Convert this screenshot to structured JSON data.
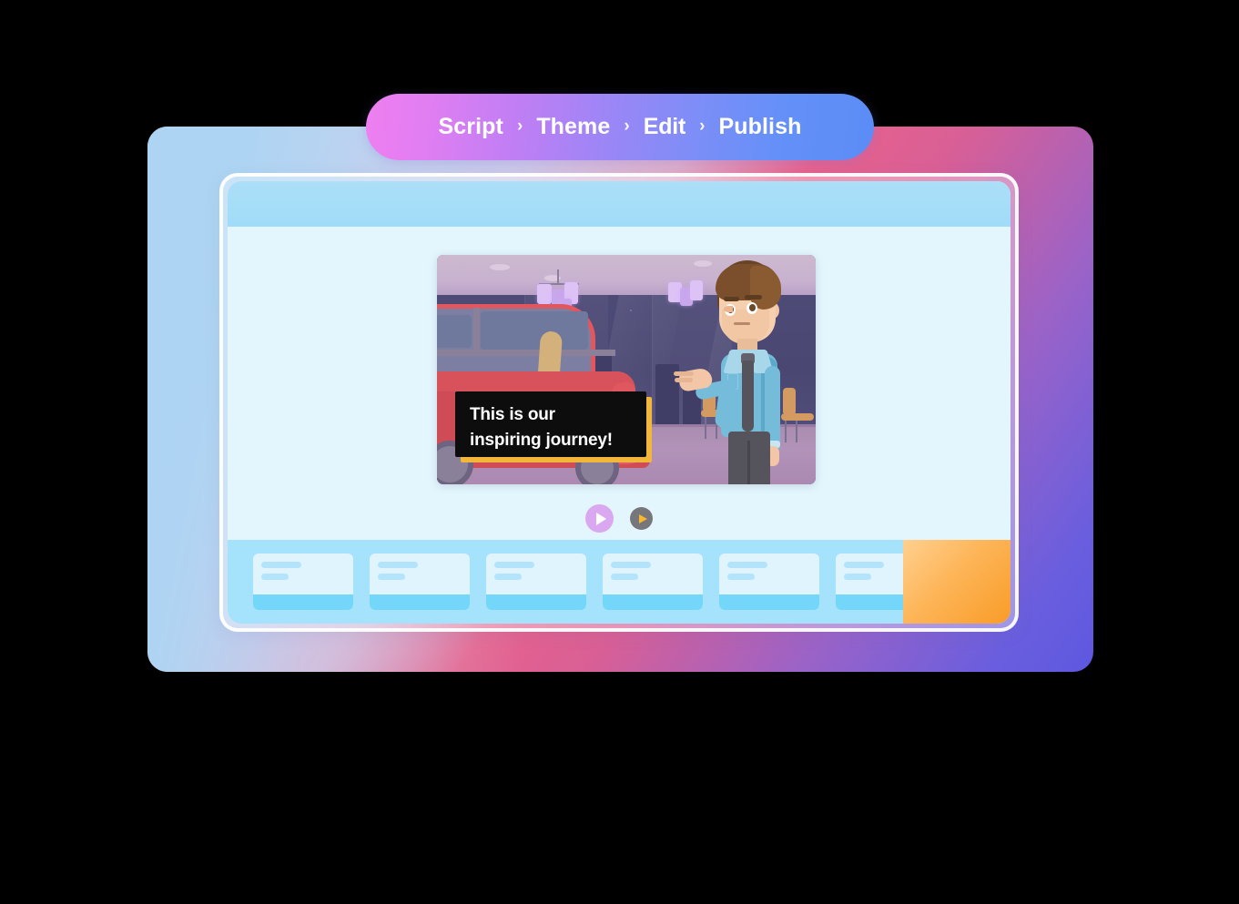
{
  "breadcrumb": {
    "separator": "›",
    "steps": [
      {
        "label": "Script",
        "active": false
      },
      {
        "label": "Theme",
        "active": false
      },
      {
        "label": "Edit",
        "active": true
      },
      {
        "label": "Publish",
        "active": false
      }
    ]
  },
  "editor": {
    "topbar_label": "",
    "video": {
      "caption_line_1": "This is our",
      "caption_line_2": "inspiring journey!",
      "scene_description": "Car showroom with presenter"
    },
    "controls": {
      "play_primary": "play-icon",
      "play_secondary": "play-icon"
    },
    "timeline": {
      "scenes": [
        {
          "id": "scene-1"
        },
        {
          "id": "scene-2"
        },
        {
          "id": "scene-3"
        },
        {
          "id": "scene-4"
        },
        {
          "id": "scene-5"
        },
        {
          "id": "scene-6"
        }
      ],
      "add_panel_label": ""
    }
  },
  "colors": {
    "accent_pink": "#ef7ff0",
    "accent_blue": "#5b8cf5",
    "caption_bg": "#0d0d0d",
    "caption_shadow": "#f2b63a",
    "timeline_bg": "#a5e2fb",
    "timeline_card": "#dff4fd",
    "timeline_card_foot": "#74d6f9",
    "orange_panel": "#f99c28",
    "play_primary": "#d9a8f0",
    "play_secondary": "#77767a",
    "topbar": "#acdff8",
    "body_bg": "#e3f6fd"
  }
}
